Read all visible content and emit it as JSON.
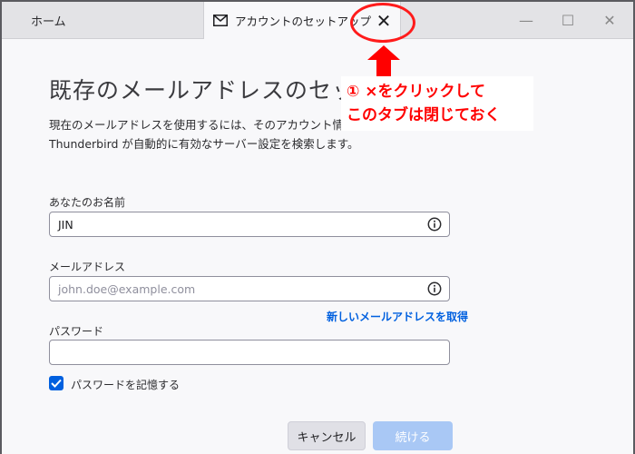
{
  "tabs": {
    "home_label": "ホーム",
    "active_label": "アカウントのセットアップ",
    "close_glyph": "✕"
  },
  "window_controls": {
    "minimize_glyph": "—",
    "maximize_glyph": "☐",
    "close_glyph": "✕"
  },
  "page": {
    "title": "既存のメールアドレスのセットアップ",
    "description_line1": "現在のメールアドレスを使用するには、そのアカウント情報を記",
    "description_line2": "Thunderbird が自動的に有効なサーバー設定を検索します。"
  },
  "form": {
    "name_label": "あなたのお名前",
    "name_value": "JIN",
    "email_label": "メールアドレス",
    "email_placeholder": "john.doe@example.com",
    "new_email_link": "新しいメールアドレスを取得",
    "password_label": "パスワード",
    "password_value": "",
    "remember_password_label": "パスワードを記憶する",
    "remember_password_checked": true
  },
  "buttons": {
    "cancel_label": "キャンセル",
    "continue_label": "続ける"
  },
  "annotation": {
    "line1": "① ×をクリックして",
    "line2": "このタブは閉じておく",
    "color": "#ff0000"
  },
  "colors": {
    "accent": "#0060df",
    "continue_disabled": "#a9c8f5",
    "annotation_red": "#ff1b1b"
  }
}
